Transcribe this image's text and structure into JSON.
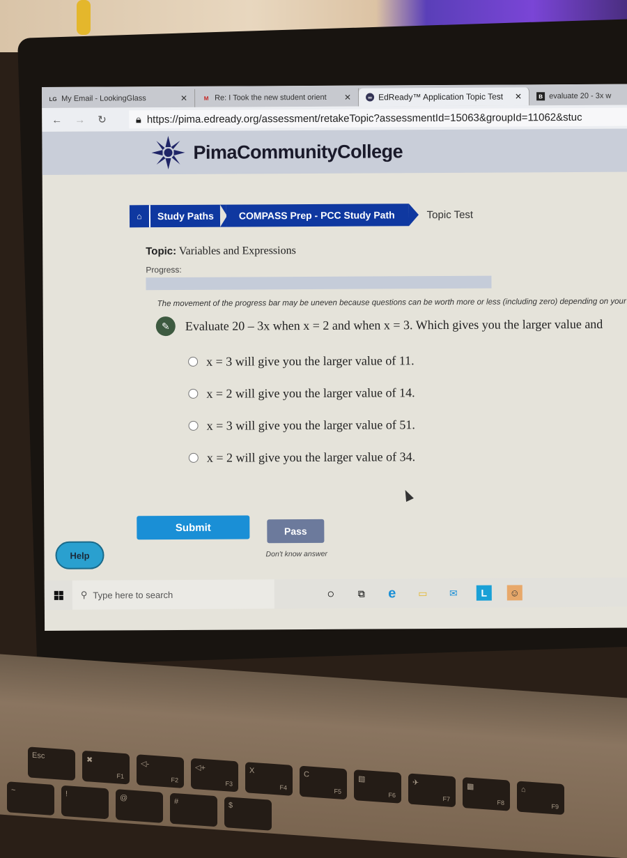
{
  "browser": {
    "tabs": [
      {
        "label": "My Email - LookingGlass",
        "favicon": "LG",
        "active": false
      },
      {
        "label": "Re: I Took the new student orient",
        "favicon": "gmail-icon",
        "active": false
      },
      {
        "label": "EdReady™ Application Topic Test",
        "favicon": "edready-icon",
        "active": true
      },
      {
        "label": "evaluate 20 - 3x w",
        "favicon": "bartleby-icon",
        "active": false
      }
    ],
    "url": "https://pima.edready.org/assessment/retakeTopic?assessmentId=15063&groupId=11062&stuc"
  },
  "site": {
    "logo_text": "PimaCommunityCollege"
  },
  "breadcrumb": {
    "items": [
      "Study Paths",
      "COMPASS Prep - PCC Study Path"
    ],
    "current": "Topic Test"
  },
  "topic": {
    "label": "Topic:",
    "name": "Variables and Expressions"
  },
  "progress": {
    "label": "Progress:",
    "value_percent": 0,
    "note": "The movement of the progress bar may be uneven because questions can be worth more or less (including zero) depending on your"
  },
  "question": {
    "text": "Evaluate 20 – 3x when x = 2 and when x = 3. Which gives you the larger value and",
    "options": [
      "x = 3 will give you the larger value of 11.",
      "x = 2 will give you the larger value of 14.",
      "x = 3 will give you the larger value of 51.",
      "x = 2 will give you the larger value of 34."
    ]
  },
  "actions": {
    "submit": "Submit",
    "pass": "Pass",
    "pass_sub": "Don't know answer",
    "help": "Help"
  },
  "taskbar": {
    "search_placeholder": "Type here to search",
    "icons": [
      "cortana-icon",
      "task-view-icon",
      "edge-icon",
      "file-explorer-icon",
      "mail-icon",
      "l-app-icon",
      "app-icon"
    ]
  },
  "keyboard": {
    "fkeys": [
      {
        "main": "Esc",
        "sub": ""
      },
      {
        "main": "✖",
        "sub": "F1"
      },
      {
        "main": "◁-",
        "sub": "F2"
      },
      {
        "main": "◁+",
        "sub": "F3"
      },
      {
        "main": "X",
        "sub": "F4"
      },
      {
        "main": "C",
        "sub": "F5"
      },
      {
        "main": "▧",
        "sub": "F6"
      },
      {
        "main": "✈",
        "sub": "F7"
      },
      {
        "main": "▩",
        "sub": "F8"
      },
      {
        "main": "⌂",
        "sub": "F9"
      }
    ],
    "numkeys": [
      "~",
      "!",
      "@",
      "#",
      "$"
    ]
  }
}
